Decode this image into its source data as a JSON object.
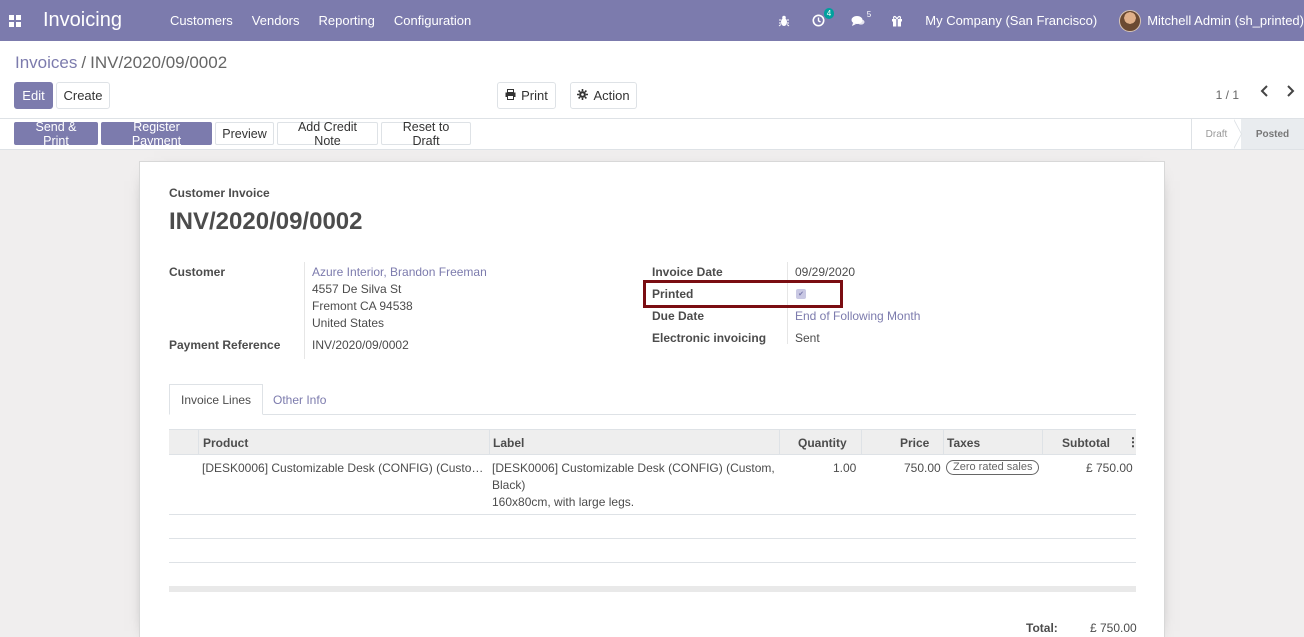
{
  "navbar": {
    "app_title": "Invoicing",
    "menu": [
      "Customers",
      "Vendors",
      "Reporting",
      "Configuration"
    ],
    "activity_badge": "4",
    "messages_badge": "5",
    "company": "My Company (San Francisco)",
    "user": "Mitchell Admin (sh_printed)"
  },
  "breadcrumb": {
    "parent": "Invoices",
    "separator": "/",
    "current": "INV/2020/09/0002"
  },
  "control": {
    "edit_label": "Edit",
    "create_label": "Create",
    "print_label": "Print",
    "action_label": "Action",
    "pager": "1 / 1"
  },
  "statusbar": {
    "buttons": [
      "Send & Print",
      "Register Payment",
      "Preview",
      "Add Credit Note",
      "Reset to Draft"
    ],
    "stages": [
      "Draft",
      "Posted"
    ],
    "active_stage": "Posted"
  },
  "invoice": {
    "type": "Customer Invoice",
    "name": "INV/2020/09/0002",
    "customer_label": "Customer",
    "customer_name": "Azure Interior, Brandon Freeman",
    "address_line1": "4557 De Silva St",
    "address_line2": "Fremont CA 94538",
    "address_line3": "United States",
    "payment_ref_label": "Payment Reference",
    "payment_ref": "INV/2020/09/0002",
    "invoice_date_label": "Invoice Date",
    "invoice_date": "09/29/2020",
    "printed_label": "Printed",
    "printed_checked": true,
    "due_date_label": "Due Date",
    "due_date": "End of Following Month",
    "einvoicing_label": "Electronic invoicing",
    "einvoicing": "Sent"
  },
  "tabs": [
    "Invoice Lines",
    "Other Info"
  ],
  "lines": {
    "headers": {
      "product": "Product",
      "label": "Label",
      "quantity": "Quantity",
      "price": "Price",
      "taxes": "Taxes",
      "subtotal": "Subtotal"
    },
    "rows": [
      {
        "product": "[DESK0006] Customizable Desk (CONFIG) (Custo…",
        "label_line1": "[DESK0006] Customizable Desk (CONFIG) (Custom,",
        "label_line2": "Black)",
        "label_line3": "160x80cm, with large legs.",
        "quantity": "1.00",
        "price": "750.00",
        "tax": "Zero rated sales",
        "subtotal": "£ 750.00"
      }
    ]
  },
  "totals": {
    "total_label": "Total:",
    "total_value": "£ 750.00"
  },
  "colors": {
    "brand": "#7c7bad",
    "highlight_box": "#7a0d12"
  }
}
